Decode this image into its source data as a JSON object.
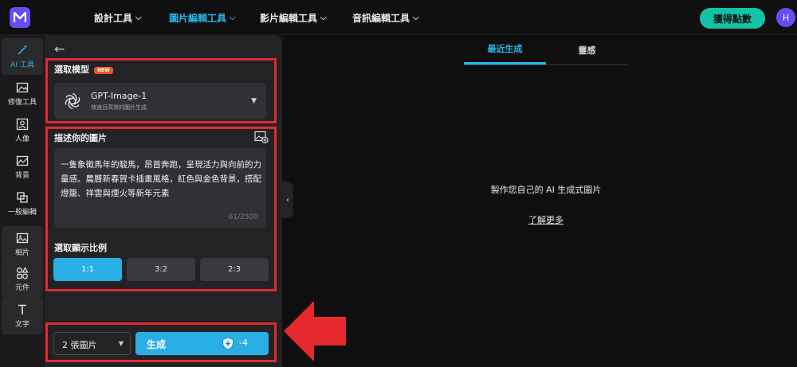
{
  "app": {
    "logo_icon": "brand-m-logo",
    "accent_color": "#27b6ea",
    "brand_color": "#6a4cf5"
  },
  "topnav": {
    "items": [
      {
        "label": "設計工具",
        "active": false
      },
      {
        "label": "圖片編輯工具",
        "active": true
      },
      {
        "label": "影片編輯工具",
        "active": false
      },
      {
        "label": "音訊編輯工具",
        "active": false
      }
    ],
    "points_button": "獲得點數",
    "avatar_letter": "H"
  },
  "rail": {
    "items": [
      {
        "label": "AI 工具",
        "icon": "magic-wand-icon",
        "active": true
      },
      {
        "label": "修復工具",
        "icon": "image-repair-icon"
      },
      {
        "label": "人像",
        "icon": "portrait-icon"
      },
      {
        "label": "背景",
        "icon": "background-icon"
      },
      {
        "label": "一般編輯",
        "icon": "crop-icon"
      },
      {
        "label": "相片",
        "icon": "photo-icon"
      },
      {
        "label": "元件",
        "icon": "shapes-icon"
      },
      {
        "label": "文字",
        "icon": "text-icon"
      }
    ]
  },
  "panel": {
    "model_section_label": "選取模型",
    "new_badge": "NEW",
    "model": {
      "name": "GPT-Image-1",
      "description": "快速且高效的圖片生成",
      "icon": "openai-logo-icon"
    },
    "prompt_section_label": "描述你的圖片",
    "prompt_text": "一隻象徵馬年的駿馬，昂首奔跑，呈現活力與向前的力量感。農曆新春賀卡插畫風格，紅色與金色背景，搭配燈籠、祥雲與煙火等新年元素",
    "char_count": "61/2500",
    "ratio_section_label": "選取顯示比例",
    "ratios": [
      {
        "label": "1:1",
        "active": true
      },
      {
        "label": "3:2",
        "active": false
      },
      {
        "label": "2:3",
        "active": false
      }
    ],
    "image_count": "2 張圖片",
    "generate_label": "生成",
    "generate_cost": "-4"
  },
  "results": {
    "tabs": [
      {
        "label": "最近生成",
        "active": true
      },
      {
        "label": "靈感",
        "active": false
      }
    ],
    "empty_title": "製作您自己的 AI 生成式圖片",
    "learn_more": "了解更多"
  },
  "annotation_color": "#e5282e"
}
